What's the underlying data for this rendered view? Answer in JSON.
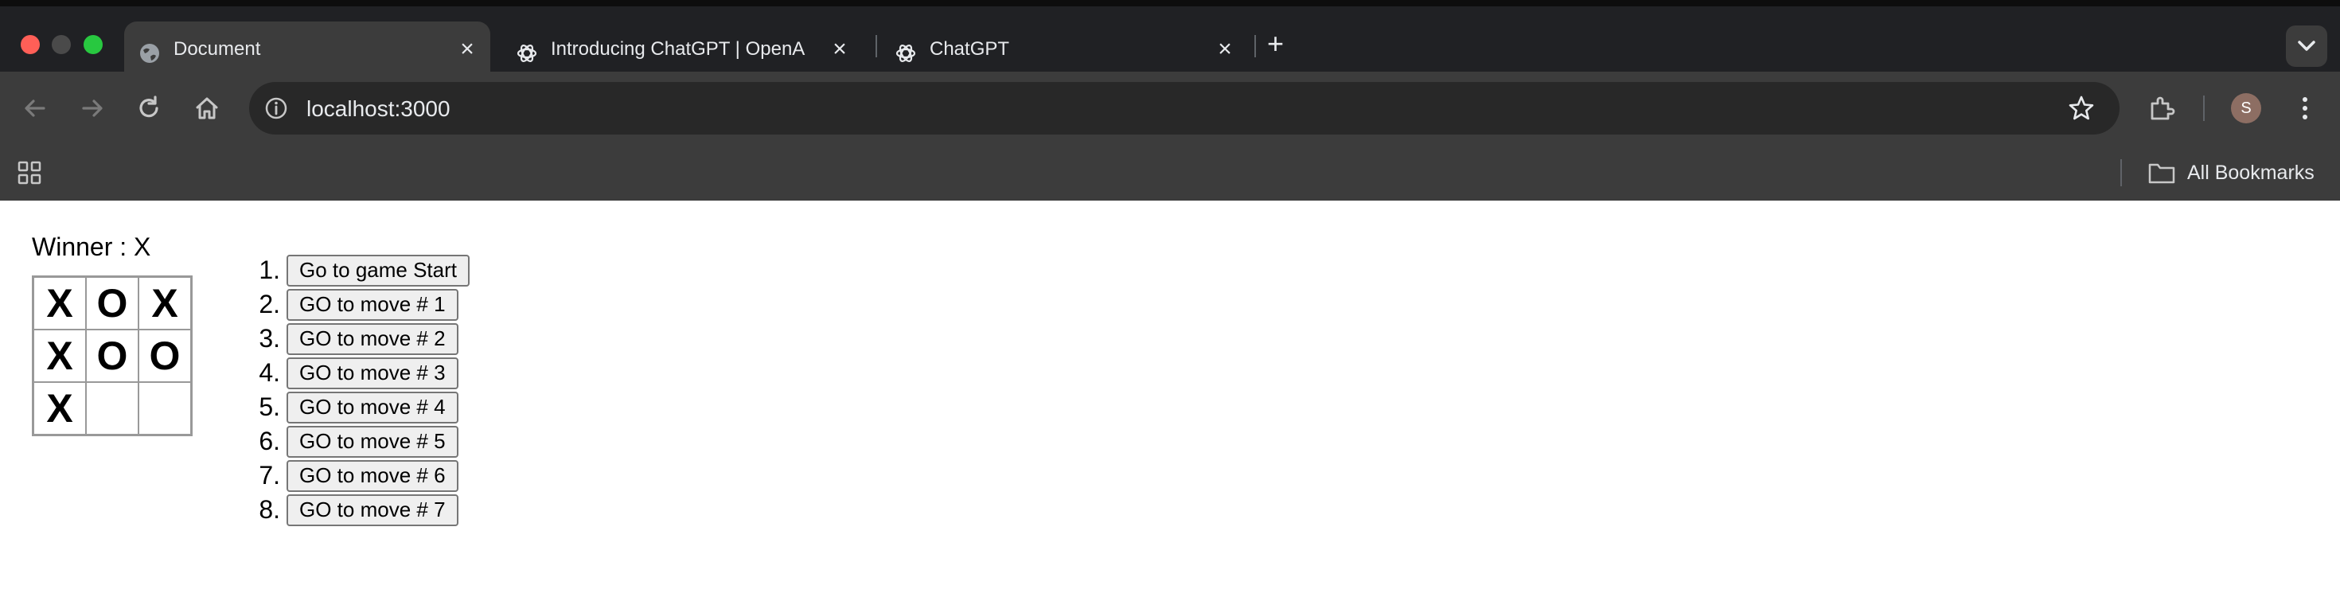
{
  "browser": {
    "tabs": [
      {
        "title": "Document",
        "favicon": "globe-icon",
        "active": true
      },
      {
        "title": "Introducing ChatGPT | OpenA",
        "favicon": "openai-icon",
        "active": false
      },
      {
        "title": "ChatGPT",
        "favicon": "openai-icon",
        "active": false
      }
    ],
    "address": "localhost:3000",
    "bookmarks_label": "All Bookmarks",
    "profile_initial": "S",
    "profile_color": "#8d6e63"
  },
  "game": {
    "status": "Winner : X",
    "board": [
      "X",
      "O",
      "X",
      "X",
      "O",
      "O",
      "X",
      "",
      ""
    ],
    "moves": [
      {
        "number": "1.",
        "label": "Go to game Start"
      },
      {
        "number": "2.",
        "label": "GO to move # 1"
      },
      {
        "number": "3.",
        "label": "GO to move # 2"
      },
      {
        "number": "4.",
        "label": "GO to move # 3"
      },
      {
        "number": "5.",
        "label": "GO to move # 4"
      },
      {
        "number": "6.",
        "label": "GO to move # 5"
      },
      {
        "number": "7.",
        "label": "GO to move # 6"
      },
      {
        "number": "8.",
        "label": "GO to move # 7"
      }
    ]
  }
}
